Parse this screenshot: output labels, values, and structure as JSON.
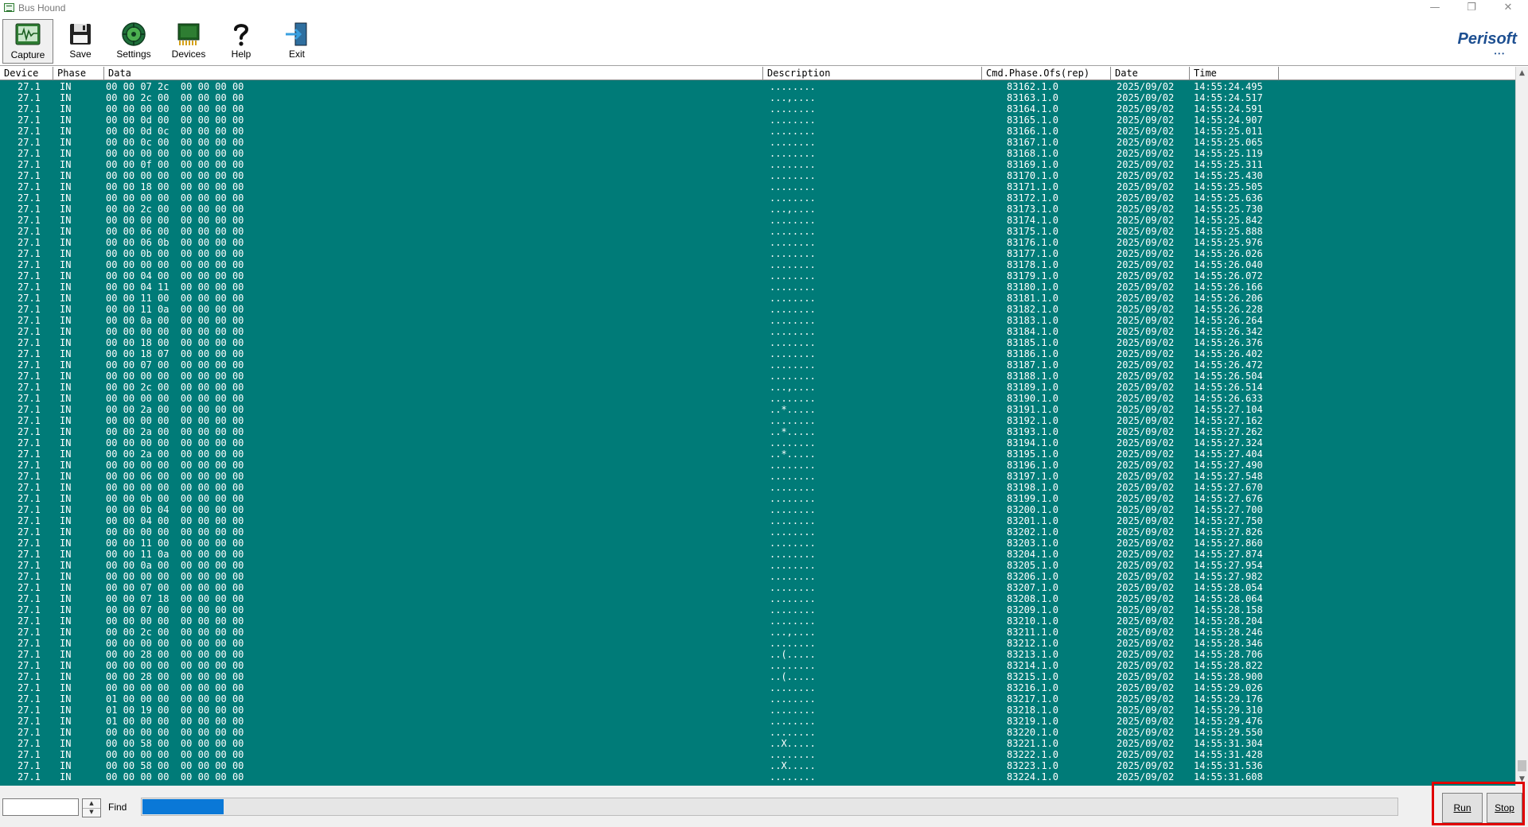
{
  "window": {
    "title": "Bus Hound",
    "controls": [
      "minimize",
      "restore",
      "close"
    ]
  },
  "toolbar": {
    "items": [
      {
        "label": "Capture",
        "icon": "oscilloscope-icon",
        "active": true
      },
      {
        "label": "Save",
        "icon": "floppy-disk-icon"
      },
      {
        "label": "Settings",
        "icon": "gear-icon"
      },
      {
        "label": "Devices",
        "icon": "chip-icon"
      },
      {
        "label": "Help",
        "icon": "question-mark-icon"
      },
      {
        "label": "Exit",
        "icon": "exit-door-icon"
      }
    ],
    "brand": "Perisoft",
    "brand_dots": "•••"
  },
  "grid": {
    "background_color": "#007b78",
    "columns": [
      "Device",
      "Phase",
      "Data",
      "Description",
      "Cmd.Phase.Ofs(rep)",
      "Date",
      "Time"
    ],
    "rows": [
      [
        "27.1",
        "IN",
        "00 00 07 2c  00 00 00 00",
        "........",
        "83162.1.0",
        "2025/09/02",
        "14:55:24.495"
      ],
      [
        "27.1",
        "IN",
        "00 00 2c 00  00 00 00 00",
        "...,....",
        "83163.1.0",
        "2025/09/02",
        "14:55:24.517"
      ],
      [
        "27.1",
        "IN",
        "00 00 00 00  00 00 00 00",
        "........",
        "83164.1.0",
        "2025/09/02",
        "14:55:24.591"
      ],
      [
        "27.1",
        "IN",
        "00 00 0d 00  00 00 00 00",
        "........",
        "83165.1.0",
        "2025/09/02",
        "14:55:24.907"
      ],
      [
        "27.1",
        "IN",
        "00 00 0d 0c  00 00 00 00",
        "........",
        "83166.1.0",
        "2025/09/02",
        "14:55:25.011"
      ],
      [
        "27.1",
        "IN",
        "00 00 0c 00  00 00 00 00",
        "........",
        "83167.1.0",
        "2025/09/02",
        "14:55:25.065"
      ],
      [
        "27.1",
        "IN",
        "00 00 00 00  00 00 00 00",
        "........",
        "83168.1.0",
        "2025/09/02",
        "14:55:25.119"
      ],
      [
        "27.1",
        "IN",
        "00 00 0f 00  00 00 00 00",
        "........",
        "83169.1.0",
        "2025/09/02",
        "14:55:25.311"
      ],
      [
        "27.1",
        "IN",
        "00 00 00 00  00 00 00 00",
        "........",
        "83170.1.0",
        "2025/09/02",
        "14:55:25.430"
      ],
      [
        "27.1",
        "IN",
        "00 00 18 00  00 00 00 00",
        "........",
        "83171.1.0",
        "2025/09/02",
        "14:55:25.505"
      ],
      [
        "27.1",
        "IN",
        "00 00 00 00  00 00 00 00",
        "........",
        "83172.1.0",
        "2025/09/02",
        "14:55:25.636"
      ],
      [
        "27.1",
        "IN",
        "00 00 2c 00  00 00 00 00",
        "...,....",
        "83173.1.0",
        "2025/09/02",
        "14:55:25.730"
      ],
      [
        "27.1",
        "IN",
        "00 00 00 00  00 00 00 00",
        "........",
        "83174.1.0",
        "2025/09/02",
        "14:55:25.842"
      ],
      [
        "27.1",
        "IN",
        "00 00 06 00  00 00 00 00",
        "........",
        "83175.1.0",
        "2025/09/02",
        "14:55:25.888"
      ],
      [
        "27.1",
        "IN",
        "00 00 06 0b  00 00 00 00",
        "........",
        "83176.1.0",
        "2025/09/02",
        "14:55:25.976"
      ],
      [
        "27.1",
        "IN",
        "00 00 0b 00  00 00 00 00",
        "........",
        "83177.1.0",
        "2025/09/02",
        "14:55:26.026"
      ],
      [
        "27.1",
        "IN",
        "00 00 00 00  00 00 00 00",
        "........",
        "83178.1.0",
        "2025/09/02",
        "14:55:26.040"
      ],
      [
        "27.1",
        "IN",
        "00 00 04 00  00 00 00 00",
        "........",
        "83179.1.0",
        "2025/09/02",
        "14:55:26.072"
      ],
      [
        "27.1",
        "IN",
        "00 00 04 11  00 00 00 00",
        "........",
        "83180.1.0",
        "2025/09/02",
        "14:55:26.166"
      ],
      [
        "27.1",
        "IN",
        "00 00 11 00  00 00 00 00",
        "........",
        "83181.1.0",
        "2025/09/02",
        "14:55:26.206"
      ],
      [
        "27.1",
        "IN",
        "00 00 11 0a  00 00 00 00",
        "........",
        "83182.1.0",
        "2025/09/02",
        "14:55:26.228"
      ],
      [
        "27.1",
        "IN",
        "00 00 0a 00  00 00 00 00",
        "........",
        "83183.1.0",
        "2025/09/02",
        "14:55:26.264"
      ],
      [
        "27.1",
        "IN",
        "00 00 00 00  00 00 00 00",
        "........",
        "83184.1.0",
        "2025/09/02",
        "14:55:26.342"
      ],
      [
        "27.1",
        "IN",
        "00 00 18 00  00 00 00 00",
        "........",
        "83185.1.0",
        "2025/09/02",
        "14:55:26.376"
      ],
      [
        "27.1",
        "IN",
        "00 00 18 07  00 00 00 00",
        "........",
        "83186.1.0",
        "2025/09/02",
        "14:55:26.402"
      ],
      [
        "27.1",
        "IN",
        "00 00 07 00  00 00 00 00",
        "........",
        "83187.1.0",
        "2025/09/02",
        "14:55:26.472"
      ],
      [
        "27.1",
        "IN",
        "00 00 00 00  00 00 00 00",
        "........",
        "83188.1.0",
        "2025/09/02",
        "14:55:26.504"
      ],
      [
        "27.1",
        "IN",
        "00 00 2c 00  00 00 00 00",
        "...,....",
        "83189.1.0",
        "2025/09/02",
        "14:55:26.514"
      ],
      [
        "27.1",
        "IN",
        "00 00 00 00  00 00 00 00",
        "........",
        "83190.1.0",
        "2025/09/02",
        "14:55:26.633"
      ],
      [
        "27.1",
        "IN",
        "00 00 2a 00  00 00 00 00",
        "..*.....",
        "83191.1.0",
        "2025/09/02",
        "14:55:27.104"
      ],
      [
        "27.1",
        "IN",
        "00 00 00 00  00 00 00 00",
        "........",
        "83192.1.0",
        "2025/09/02",
        "14:55:27.162"
      ],
      [
        "27.1",
        "IN",
        "00 00 2a 00  00 00 00 00",
        "..*.....",
        "83193.1.0",
        "2025/09/02",
        "14:55:27.262"
      ],
      [
        "27.1",
        "IN",
        "00 00 00 00  00 00 00 00",
        "........",
        "83194.1.0",
        "2025/09/02",
        "14:55:27.324"
      ],
      [
        "27.1",
        "IN",
        "00 00 2a 00  00 00 00 00",
        "..*.....",
        "83195.1.0",
        "2025/09/02",
        "14:55:27.404"
      ],
      [
        "27.1",
        "IN",
        "00 00 00 00  00 00 00 00",
        "........",
        "83196.1.0",
        "2025/09/02",
        "14:55:27.490"
      ],
      [
        "27.1",
        "IN",
        "00 00 06 00  00 00 00 00",
        "........",
        "83197.1.0",
        "2025/09/02",
        "14:55:27.548"
      ],
      [
        "27.1",
        "IN",
        "00 00 00 00  00 00 00 00",
        "........",
        "83198.1.0",
        "2025/09/02",
        "14:55:27.670"
      ],
      [
        "27.1",
        "IN",
        "00 00 0b 00  00 00 00 00",
        "........",
        "83199.1.0",
        "2025/09/02",
        "14:55:27.676"
      ],
      [
        "27.1",
        "IN",
        "00 00 0b 04  00 00 00 00",
        "........",
        "83200.1.0",
        "2025/09/02",
        "14:55:27.700"
      ],
      [
        "27.1",
        "IN",
        "00 00 04 00  00 00 00 00",
        "........",
        "83201.1.0",
        "2025/09/02",
        "14:55:27.750"
      ],
      [
        "27.1",
        "IN",
        "00 00 00 00  00 00 00 00",
        "........",
        "83202.1.0",
        "2025/09/02",
        "14:55:27.826"
      ],
      [
        "27.1",
        "IN",
        "00 00 11 00  00 00 00 00",
        "........",
        "83203.1.0",
        "2025/09/02",
        "14:55:27.860"
      ],
      [
        "27.1",
        "IN",
        "00 00 11 0a  00 00 00 00",
        "........",
        "83204.1.0",
        "2025/09/02",
        "14:55:27.874"
      ],
      [
        "27.1",
        "IN",
        "00 00 0a 00  00 00 00 00",
        "........",
        "83205.1.0",
        "2025/09/02",
        "14:55:27.954"
      ],
      [
        "27.1",
        "IN",
        "00 00 00 00  00 00 00 00",
        "........",
        "83206.1.0",
        "2025/09/02",
        "14:55:27.982"
      ],
      [
        "27.1",
        "IN",
        "00 00 07 00  00 00 00 00",
        "........",
        "83207.1.0",
        "2025/09/02",
        "14:55:28.054"
      ],
      [
        "27.1",
        "IN",
        "00 00 07 18  00 00 00 00",
        "........",
        "83208.1.0",
        "2025/09/02",
        "14:55:28.064"
      ],
      [
        "27.1",
        "IN",
        "00 00 07 00  00 00 00 00",
        "........",
        "83209.1.0",
        "2025/09/02",
        "14:55:28.158"
      ],
      [
        "27.1",
        "IN",
        "00 00 00 00  00 00 00 00",
        "........",
        "83210.1.0",
        "2025/09/02",
        "14:55:28.204"
      ],
      [
        "27.1",
        "IN",
        "00 00 2c 00  00 00 00 00",
        "...,....",
        "83211.1.0",
        "2025/09/02",
        "14:55:28.246"
      ],
      [
        "27.1",
        "IN",
        "00 00 00 00  00 00 00 00",
        "........",
        "83212.1.0",
        "2025/09/02",
        "14:55:28.346"
      ],
      [
        "27.1",
        "IN",
        "00 00 28 00  00 00 00 00",
        "..(.....",
        "83213.1.0",
        "2025/09/02",
        "14:55:28.706"
      ],
      [
        "27.1",
        "IN",
        "00 00 00 00  00 00 00 00",
        "........",
        "83214.1.0",
        "2025/09/02",
        "14:55:28.822"
      ],
      [
        "27.1",
        "IN",
        "00 00 28 00  00 00 00 00",
        "..(.....",
        "83215.1.0",
        "2025/09/02",
        "14:55:28.900"
      ],
      [
        "27.1",
        "IN",
        "00 00 00 00  00 00 00 00",
        "........",
        "83216.1.0",
        "2025/09/02",
        "14:55:29.026"
      ],
      [
        "27.1",
        "IN",
        "01 00 00 00  00 00 00 00",
        "........",
        "83217.1.0",
        "2025/09/02",
        "14:55:29.176"
      ],
      [
        "27.1",
        "IN",
        "01 00 19 00  00 00 00 00",
        "........",
        "83218.1.0",
        "2025/09/02",
        "14:55:29.310"
      ],
      [
        "27.1",
        "IN",
        "01 00 00 00  00 00 00 00",
        "........",
        "83219.1.0",
        "2025/09/02",
        "14:55:29.476"
      ],
      [
        "27.1",
        "IN",
        "00 00 00 00  00 00 00 00",
        "........",
        "83220.1.0",
        "2025/09/02",
        "14:55:29.550"
      ],
      [
        "27.1",
        "IN",
        "00 00 58 00  00 00 00 00",
        "..X.....",
        "83221.1.0",
        "2025/09/02",
        "14:55:31.304"
      ],
      [
        "27.1",
        "IN",
        "00 00 00 00  00 00 00 00",
        "........",
        "83222.1.0",
        "2025/09/02",
        "14:55:31.428"
      ],
      [
        "27.1",
        "IN",
        "00 00 58 00  00 00 00 00",
        "..X.....",
        "83223.1.0",
        "2025/09/02",
        "14:55:31.536"
      ],
      [
        "27.1",
        "IN",
        "00 00 00 00  00 00 00 00",
        "........",
        "83224.1.0",
        "2025/09/02",
        "14:55:31.608"
      ]
    ]
  },
  "bottom": {
    "find_input_value": "",
    "find_label": "Find",
    "progress_fraction": 0.065,
    "run_label": "Run",
    "stop_label": "Stop",
    "highlight_color": "#e00000"
  }
}
